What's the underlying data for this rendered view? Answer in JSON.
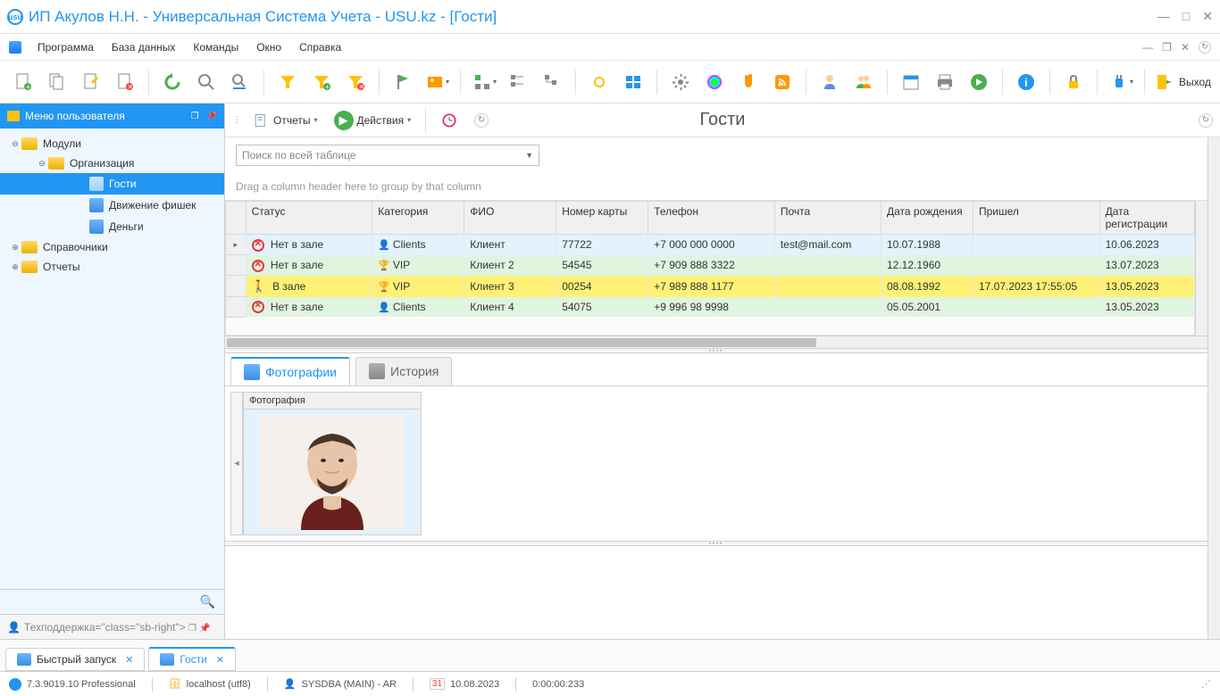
{
  "title": "ИП Акулов Н.Н. - Универсальная Система Учета - USU.kz - [Гости]",
  "menu": {
    "items": [
      "Программа",
      "База данных",
      "Команды",
      "Окно",
      "Справка"
    ]
  },
  "toolbar": {
    "exit_label": "Выход"
  },
  "sidebar": {
    "header": "Меню пользователя",
    "nodes": {
      "modules": "Модули",
      "org": "Организация",
      "guests": "Гости",
      "chips": "Движение фишек",
      "money": "Деньги",
      "refs": "Справочники",
      "reports": "Отчеты"
    },
    "support": "Техподдержка"
  },
  "subtoolbar": {
    "reports": "Отчеты",
    "actions": "Действия",
    "title": "Гости"
  },
  "search": {
    "placeholder": "Поиск по всей таблице"
  },
  "grid": {
    "group_hint": "Drag a column header here to group by that column",
    "columns": [
      "Статус",
      "Категория",
      "ФИО",
      "Номер карты",
      "Телефон",
      "Почта",
      "Дата рождения",
      "Пришел",
      "Дата регистрации"
    ],
    "rows": [
      {
        "status": "Нет в зале",
        "status_type": "no",
        "cat": "Clients",
        "cat_type": "client",
        "fio": "Клиент",
        "card": "77722",
        "tel": "+7 000 000 0000",
        "email": "test@mail.com",
        "birth": "10.07.1988",
        "came": "",
        "reg": "10.06.2023",
        "cls": "r-blue"
      },
      {
        "status": "Нет в зале",
        "status_type": "no",
        "cat": "VIP",
        "cat_type": "vip",
        "fio": "Клиент 2",
        "card": "54545",
        "tel": "+7 909 888 3322",
        "email": "",
        "birth": "12.12.1960",
        "came": "",
        "reg": "13.07.2023",
        "cls": "r-green"
      },
      {
        "status": "В зале",
        "status_type": "yes",
        "cat": "VIP",
        "cat_type": "vip",
        "fio": "Клиент 3",
        "card": "00254",
        "tel": "+7 989 888 1177",
        "email": "",
        "birth": "08.08.1992",
        "came": "17.07.2023 17:55:05",
        "reg": "13.05.2023",
        "cls": "r-yellow"
      },
      {
        "status": "Нет в зале",
        "status_type": "no",
        "cat": "Clients",
        "cat_type": "client",
        "fio": "Клиент 4",
        "card": "54075",
        "tel": "+9 996 98 9998",
        "email": "",
        "birth": "05.05.2001",
        "came": "",
        "reg": "13.05.2023",
        "cls": "r-green"
      }
    ]
  },
  "tabs": {
    "photos": "Фотографии",
    "history": "История"
  },
  "photo": {
    "header": "Фотография"
  },
  "bottom_tabs": {
    "quick": "Быстрый запуск",
    "guests": "Гости"
  },
  "status": {
    "version": "7.3.9019.10 Professional",
    "host": "localhost (utf8)",
    "user": "SYSDBA (MAIN) - AR",
    "date": "10.08.2023",
    "timer": "0:00:00:233"
  }
}
